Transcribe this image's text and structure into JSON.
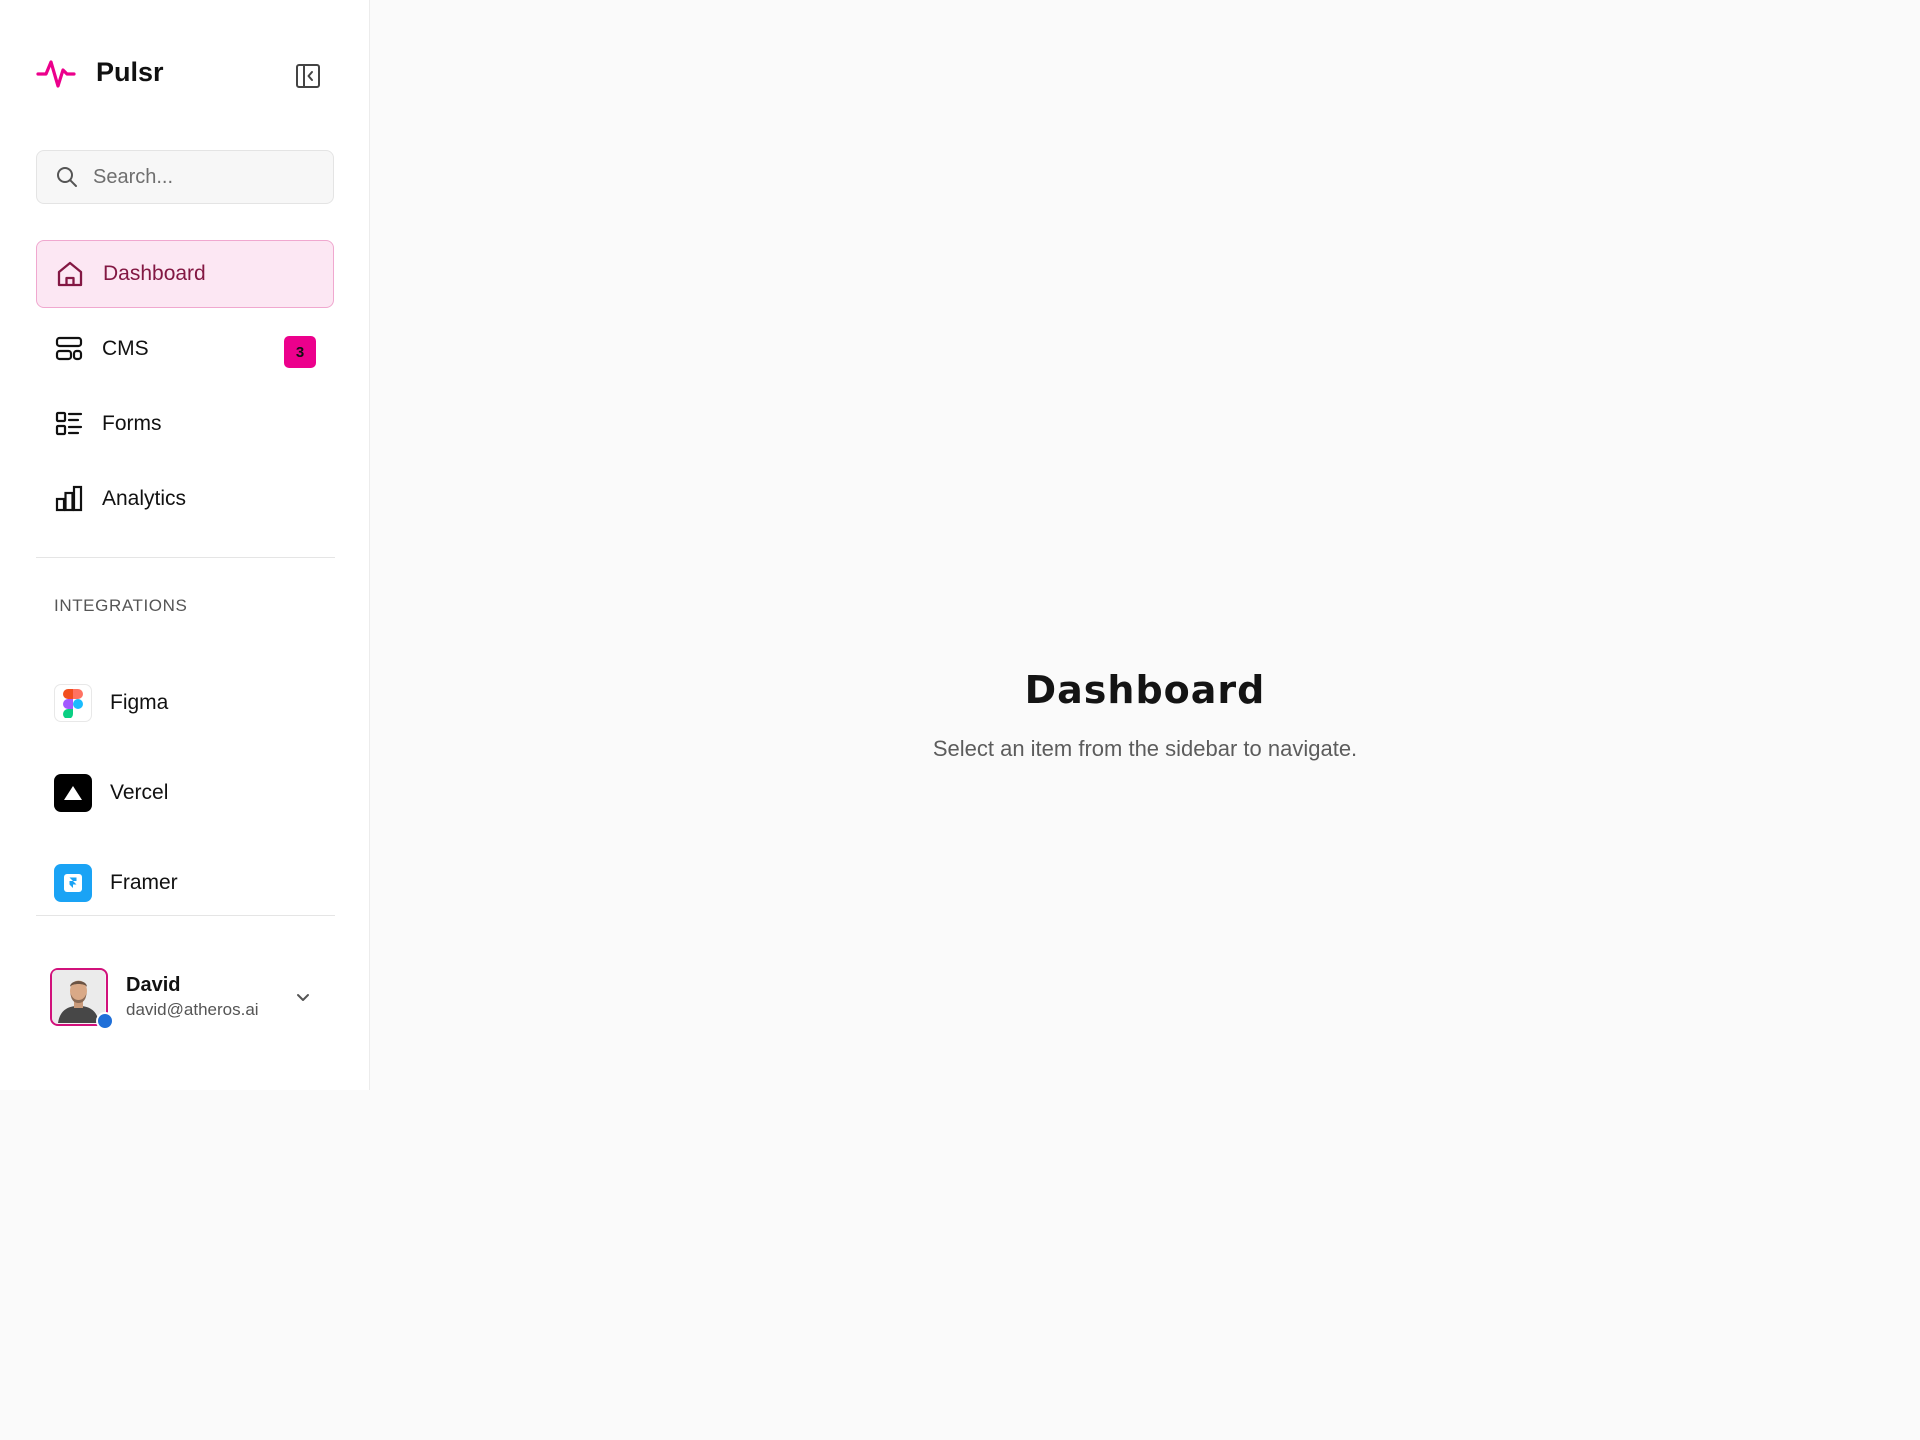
{
  "brand": {
    "name": "Pulsr",
    "accent": "#ec008c"
  },
  "search": {
    "placeholder": "Search..."
  },
  "nav": [
    {
      "label": "Dashboard",
      "icon": "home-icon",
      "active": true
    },
    {
      "label": "CMS",
      "icon": "cms-icon",
      "badge": "3"
    },
    {
      "label": "Forms",
      "icon": "forms-icon"
    },
    {
      "label": "Analytics",
      "icon": "analytics-icon"
    }
  ],
  "integrations": {
    "title": "INTEGRATIONS",
    "items": [
      {
        "label": "Figma",
        "icon": "figma-icon"
      },
      {
        "label": "Vercel",
        "icon": "vercel-icon"
      },
      {
        "label": "Framer",
        "icon": "framer-icon"
      }
    ]
  },
  "user": {
    "name": "David",
    "email": "david@atheros.ai",
    "status_color": "#1f6fd8"
  },
  "main": {
    "title": "Dashboard",
    "subtitle": "Select an item from the sidebar to navigate."
  }
}
